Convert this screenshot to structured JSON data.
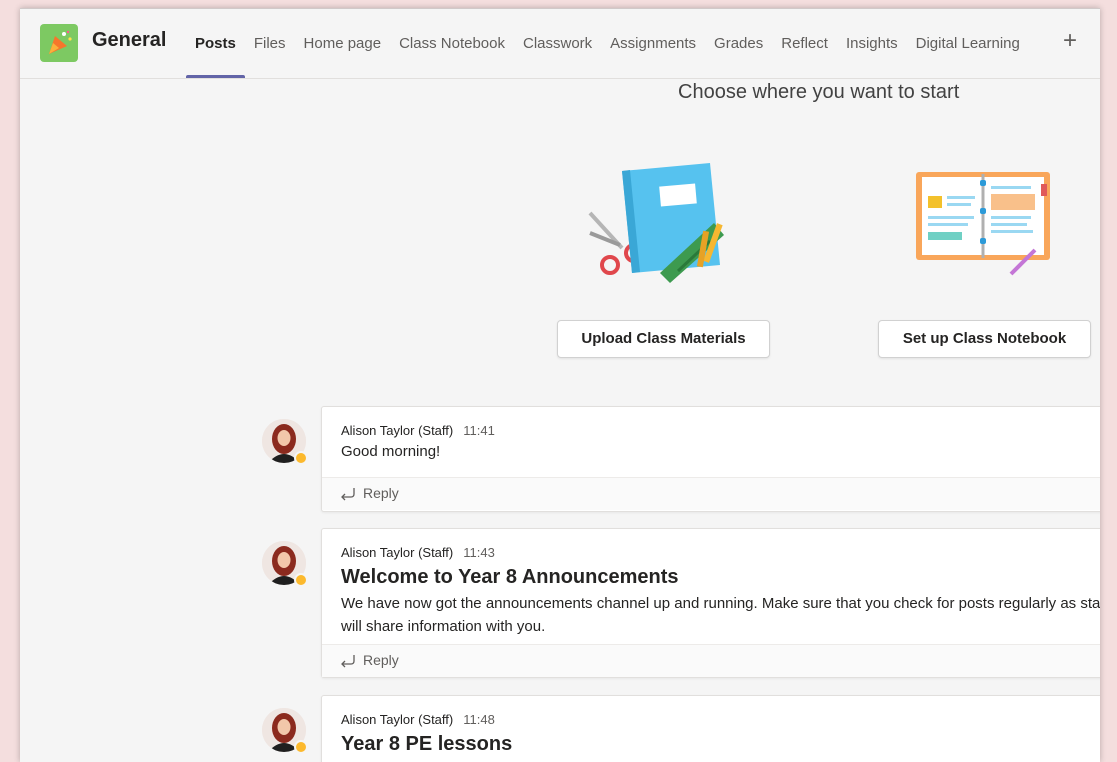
{
  "team": {
    "name": "General",
    "logo_color": "#7dc962"
  },
  "tabs": [
    {
      "label": "Posts",
      "active": true
    },
    {
      "label": "Files"
    },
    {
      "label": "Home page"
    },
    {
      "label": "Class Notebook"
    },
    {
      "label": "Classwork"
    },
    {
      "label": "Assignments"
    },
    {
      "label": "Grades"
    },
    {
      "label": "Reflect"
    },
    {
      "label": "Insights"
    },
    {
      "label": "Digital Learning"
    }
  ],
  "add_tab_icon": "plus-icon",
  "start": {
    "title": "Choose where you want to start",
    "upload_label": "Upload Class Materials",
    "notebook_label": "Set up Class Notebook"
  },
  "posts": [
    {
      "author": "Alison Taylor (Staff)",
      "time": "11:41",
      "message": "Good morning!",
      "reply_label": "Reply"
    },
    {
      "author": "Alison Taylor (Staff)",
      "time": "11:43",
      "subject": "Welcome to Year 8 Announcements",
      "message": "We have now  got the announcements channel up and running. Make sure that you check for posts regularly as staff will share information with you.",
      "reply_label": "Reply"
    },
    {
      "author": "Alison Taylor (Staff)",
      "time": "11:48",
      "subject": "Year 8 PE lessons"
    }
  ],
  "colors": {
    "accent": "#6264a7",
    "status_away": "#fcb92d"
  }
}
